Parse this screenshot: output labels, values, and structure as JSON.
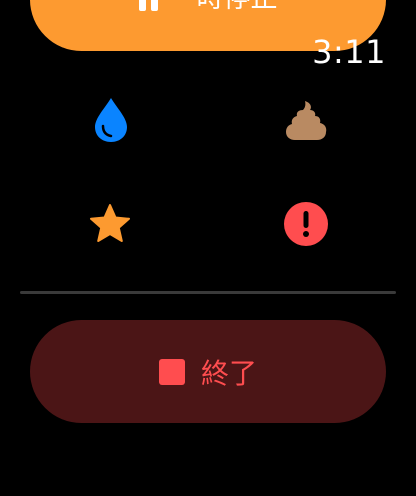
{
  "pause_button": {
    "label": "一時停止",
    "color": "#fd9a30",
    "icon": "pause-icon"
  },
  "clock": {
    "time": "3:11"
  },
  "actions": [
    {
      "name": "water",
      "icon": "water-drop-icon",
      "color": "#0a84ff"
    },
    {
      "name": "poop",
      "icon": "poop-icon",
      "color": "#b98a62"
    },
    {
      "name": "favorite",
      "icon": "star-icon",
      "color": "#fd9a30"
    },
    {
      "name": "alert",
      "icon": "exclamation-icon",
      "color": "#ff4d4f"
    }
  ],
  "end_button": {
    "label": "終了",
    "icon": "stop-icon",
    "color": "#ff4d4f",
    "background": "#4b1516"
  }
}
